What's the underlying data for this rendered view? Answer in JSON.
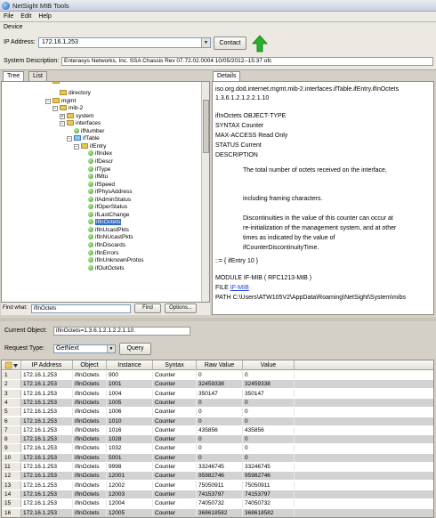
{
  "window": {
    "title": "NetSight MIB Tools"
  },
  "menu": {
    "items": [
      "File",
      "Edit",
      "Help"
    ]
  },
  "device": {
    "group_label": "Device",
    "ip_label": "IP Address:",
    "ip_value": "172.16.1.253",
    "contact_label": "Contact",
    "sysdesc_label": "System Description:",
    "sysdesc_value": "Enterasys Networks, Inc. SSA Chassis Rev 07.72.02.0004 10/05/2012--15:37 ofc"
  },
  "left_tabs": [
    "Tree",
    "List"
  ],
  "right_tabs": [
    "Details"
  ],
  "tree": {
    "nodes": [
      {
        "label": "directory",
        "type": "folder"
      },
      {
        "label": "mgmt",
        "type": "folder"
      },
      {
        "label": "mib-2",
        "type": "folder"
      },
      {
        "label": "system",
        "type": "folder"
      },
      {
        "label": "interfaces",
        "type": "folder"
      },
      {
        "label": "ifNumber",
        "type": "leaf"
      },
      {
        "label": "ifTable",
        "type": "table"
      },
      {
        "label": "ifEntry",
        "type": "folder"
      },
      {
        "label": "ifIndex",
        "type": "leaf"
      },
      {
        "label": "ifDescr",
        "type": "leaf"
      },
      {
        "label": "ifType",
        "type": "leaf"
      },
      {
        "label": "ifMtu",
        "type": "leaf"
      },
      {
        "label": "ifSpeed",
        "type": "leaf"
      },
      {
        "label": "ifPhysAddress",
        "type": "leaf"
      },
      {
        "label": "ifAdminStatus",
        "type": "leaf"
      },
      {
        "label": "ifOperStatus",
        "type": "leaf"
      },
      {
        "label": "ifLastChange",
        "type": "leaf"
      },
      {
        "label": "ifInOctets",
        "type": "leaf",
        "selected": true
      },
      {
        "label": "ifInUcastPkts",
        "type": "leaf"
      },
      {
        "label": "ifInNUcastPkts",
        "type": "leaf"
      },
      {
        "label": "ifInDiscards",
        "type": "leaf"
      },
      {
        "label": "ifInErrors",
        "type": "leaf"
      },
      {
        "label": "ifInUnknownProtos",
        "type": "leaf"
      },
      {
        "label": "ifOutOctets",
        "type": "leaf"
      }
    ]
  },
  "find": {
    "label": "Find what:",
    "value": "ifInOctets",
    "find_label": "Find",
    "options_label": "Options..."
  },
  "details": {
    "oid_path": "iso.org.dod.internet.mgmt.mib-2.interfaces.ifTable.ifEntry.ifInOctets",
    "oid": "1.3.6.1.2.1.2.2.1.10",
    "object_type": "ifInOctets OBJECT-TYPE",
    "syntax": "SYNTAX Counter",
    "max_access": "MAX-ACCESS Read Only",
    "status": "STATUS Current",
    "description_label": "DESCRIPTION",
    "desc1": "The total number of octets received on the interface,",
    "desc2": "including framing characters.",
    "desc3": "Discontinuities in the value of this counter can occur at",
    "desc4": "re-initialization of the management system, and at other",
    "desc5": "times as indicated by the value of",
    "desc6": "ifCounterDiscontinuityTime.",
    "assign": "::= { ifEntry 10 }",
    "module": "MODULE IF-MIB ( RFC1213-MIB )",
    "file_label": "FILE",
    "file_link": "IF-MIB",
    "path": "PATH C:\\Users\\ATW105V2\\AppData\\Roaming\\NetSight\\System\\mibs"
  },
  "current_object": {
    "label": "Current Object:",
    "value": "ifInOctets=1.3.6.1.2.1.2.2.1.10."
  },
  "request": {
    "label": "Request Type:",
    "value": "GetNext",
    "query_label": "Query"
  },
  "results": {
    "columns": [
      "IP Address",
      "Object",
      "Instance",
      "Syntax",
      "Raw Value",
      "Value"
    ],
    "rows": [
      [
        "1",
        "172.16.1.253",
        "ifInOctets",
        "900",
        "Counter",
        "0",
        "0"
      ],
      [
        "2",
        "172.16.1.253",
        "ifInOctets",
        "1001",
        "Counter",
        "32459338",
        "32459338"
      ],
      [
        "3",
        "172.16.1.253",
        "ifInOctets",
        "1004",
        "Counter",
        "350147",
        "350147"
      ],
      [
        "4",
        "172.16.1.253",
        "ifInOctets",
        "1005",
        "Counter",
        "0",
        "0"
      ],
      [
        "5",
        "172.16.1.253",
        "ifInOctets",
        "1006",
        "Counter",
        "0",
        "0"
      ],
      [
        "6",
        "172.16.1.253",
        "ifInOctets",
        "1010",
        "Counter",
        "0",
        "0"
      ],
      [
        "7",
        "172.16.1.253",
        "ifInOctets",
        "1016",
        "Counter",
        "435856",
        "435856"
      ],
      [
        "8",
        "172.16.1.253",
        "ifInOctets",
        "1028",
        "Counter",
        "0",
        "0"
      ],
      [
        "9",
        "172.16.1.253",
        "ifInOctets",
        "1032",
        "Counter",
        "0",
        "0"
      ],
      [
        "10",
        "172.16.1.253",
        "ifInOctets",
        "5001",
        "Counter",
        "0",
        "0"
      ],
      [
        "11",
        "172.16.1.253",
        "ifInOctets",
        "9998",
        "Counter",
        "33246745",
        "33246745"
      ],
      [
        "12",
        "172.16.1.253",
        "ifInOctets",
        "12001",
        "Counter",
        "95982746",
        "95982746"
      ],
      [
        "13",
        "172.16.1.253",
        "ifInOctets",
        "12002",
        "Counter",
        "75050911",
        "75050911"
      ],
      [
        "14",
        "172.16.1.253",
        "ifInOctets",
        "12003",
        "Counter",
        "74153797",
        "74153797"
      ],
      [
        "15",
        "172.16.1.253",
        "ifInOctets",
        "12004",
        "Counter",
        "74050732",
        "74050732"
      ],
      [
        "16",
        "172.16.1.253",
        "ifInOctets",
        "12005",
        "Counter",
        "368618582",
        "368618582"
      ]
    ]
  }
}
